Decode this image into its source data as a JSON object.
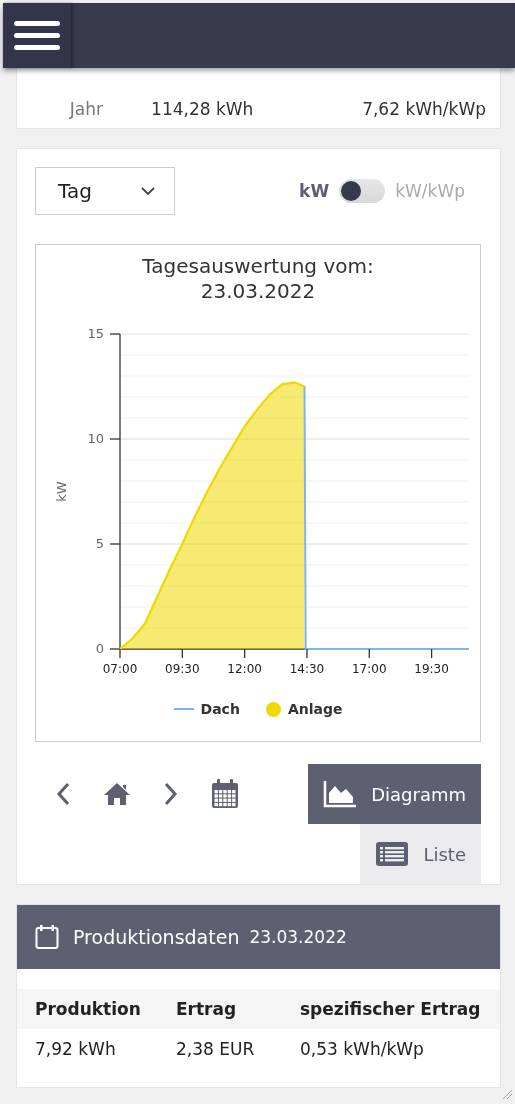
{
  "summary": {
    "rows": [
      {
        "label": "Jahr",
        "energy": "114,28 kWh",
        "specific": "7,62 kWh/kWp"
      }
    ]
  },
  "period_select": {
    "value": "Tag"
  },
  "unit_toggle": {
    "off_label": "kW",
    "on_label": "kW/kWp",
    "on": false
  },
  "chart": {
    "title": "Tagesauswertung vom:",
    "date": "23.03.2022",
    "chart_data": {
      "type": "area",
      "ylabel": "kW",
      "x": [
        7,
        7.5,
        8,
        8.5,
        9,
        9.5,
        10,
        10.5,
        11,
        11.5,
        12,
        12.5,
        13,
        13.5,
        14,
        14.4,
        14.45,
        15,
        16,
        17,
        18,
        19,
        20,
        21
      ],
      "series": [
        {
          "name": "Dach",
          "type": "line",
          "color": "#7cb5ec",
          "values": [
            null,
            null,
            null,
            null,
            null,
            null,
            null,
            null,
            null,
            null,
            null,
            null,
            null,
            null,
            null,
            12.5,
            0,
            0,
            0,
            0,
            0,
            0,
            0,
            0
          ]
        },
        {
          "name": "Anlage",
          "color": "#f0d800",
          "values": [
            0,
            0.5,
            1.2,
            2.5,
            3.8,
            5.0,
            6.3,
            7.5,
            8.6,
            9.6,
            10.6,
            11.4,
            12.1,
            12.6,
            12.7,
            12.5,
            null,
            null,
            null,
            null,
            null,
            null,
            null,
            null
          ]
        }
      ],
      "xlim": [
        7,
        21
      ],
      "ylim": [
        0,
        15
      ],
      "xticks": [
        {
          "value": 7,
          "label": "07:00"
        },
        {
          "value": 9.5,
          "label": "09:30"
        },
        {
          "value": 12,
          "label": "12:00"
        },
        {
          "value": 14.5,
          "label": "14:30"
        },
        {
          "value": 17,
          "label": "17:00"
        },
        {
          "value": 19.5,
          "label": "19:30"
        }
      ],
      "yticks": [
        0,
        5,
        10,
        15
      ]
    }
  },
  "views": [
    {
      "label": "Diagramm",
      "kind": "chart",
      "selected": true
    },
    {
      "label": "Liste",
      "kind": "list",
      "selected": false
    }
  ],
  "production": {
    "title": "Produktionsdaten",
    "date": "23.03.2022",
    "columns": [
      "Produktion",
      "Ertrag",
      "spezifischer Ertrag"
    ],
    "rows": [
      [
        "7,92 kWh",
        "2,38 EUR",
        "0,53 kWh/kWp"
      ]
    ]
  }
}
